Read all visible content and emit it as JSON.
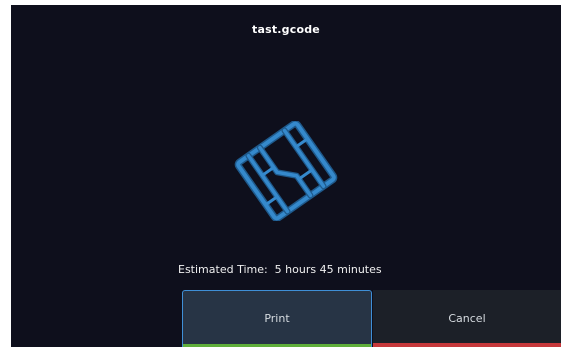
{
  "header": {
    "filename": "tast.gcode"
  },
  "preview": {
    "icon": "model-thumbnail"
  },
  "info": {
    "estimated_time": "Estimated Time:  5 hours 45 minutes"
  },
  "actions": {
    "print_label": "Print",
    "cancel_label": "Cancel"
  },
  "colors": {
    "background": "#0e0f1c",
    "model": "#2f7ab8",
    "print_border": "#3f8fd6",
    "print_accent": "#5fae3a",
    "cancel_accent": "#c6383b"
  }
}
